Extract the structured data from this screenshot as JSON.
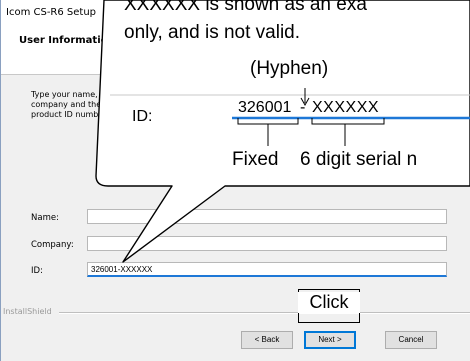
{
  "window": {
    "title": "Icom CS-R6 Setup"
  },
  "header": {
    "title": "User Information"
  },
  "instructions": "Type your name, company and the product ID number.",
  "form": {
    "name_label": "Name:",
    "name_value": "",
    "company_label": "Company:",
    "company_value": "",
    "id_label": "ID:",
    "id_value": "326001-XXXXXX"
  },
  "footer": {
    "installshield": "InstallShield"
  },
  "buttons": {
    "back": "< Back",
    "next": "Next >",
    "cancel": "Cancel"
  },
  "callout": {
    "line1": "XXXXXX is shown as an exa",
    "line2": "only, and is not valid.",
    "hyphen_label": "(Hyphen)",
    "id_label": "ID:",
    "id_prefix": "326001",
    "id_hyphen": "-",
    "id_serial": "XXXXXX",
    "fixed_label": "Fixed",
    "serial_label": "6 digit serial n"
  },
  "click_label": "Click",
  "colors": {
    "focus_blue": "#0078d7",
    "field_border": "#b8b8b8"
  }
}
